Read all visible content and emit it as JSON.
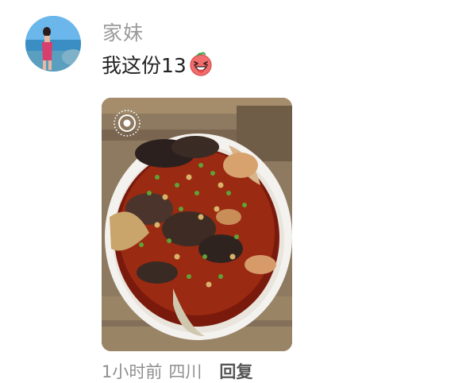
{
  "comment": {
    "username": "家妹",
    "text": "我这份13",
    "emoji": "laughing-face-emoji",
    "time": "1小时前",
    "location": "四川",
    "reply_label": "回复",
    "has_live_photo": true
  },
  "colors": {
    "username": "#9a9a9a",
    "text": "#222222",
    "meta": "#8f8f8f",
    "reply": "#555555"
  }
}
